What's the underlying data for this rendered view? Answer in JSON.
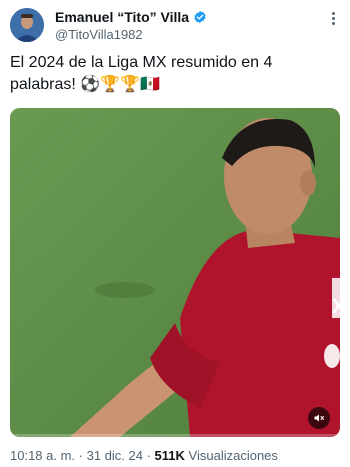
{
  "author": {
    "display_name": "Emanuel “Tito” Villa",
    "handle": "@TitoVilla1982",
    "verified": true
  },
  "tweet": {
    "text": "El 2024 de la Liga MX resumido en 4 palabras! ",
    "emojis": "⚽🏆🏆🇲🇽"
  },
  "media": {
    "type": "video",
    "jersey_text": "X",
    "progress": 0.0
  },
  "meta": {
    "time": "10:18 a. m.",
    "separator1": " · ",
    "date": "31 dic. 24",
    "separator2": " · ",
    "views_count": "511K",
    "views_label": " Visualizaciones"
  },
  "colors": {
    "verified_blue": "#1d9bf0",
    "jersey_red": "#b0142c",
    "pitch_green": "#5a8b45"
  },
  "icons": {
    "verified": "verified-badge-icon",
    "more": "more-options-icon",
    "mute": "volume-muted-icon"
  }
}
